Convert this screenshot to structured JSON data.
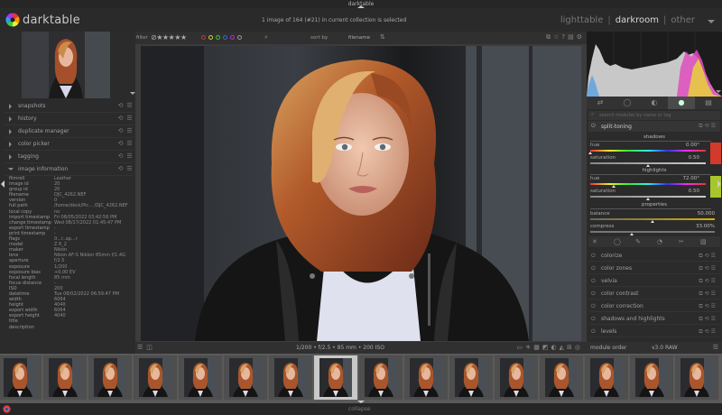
{
  "window": {
    "title": "darktable"
  },
  "header": {
    "app_name": "darktable",
    "selection_info": "1 image of 164 (#21) in current collection is selected",
    "views": {
      "lighttable": "lighttable",
      "darkroom": "darkroom",
      "other": "other",
      "separator": "|"
    }
  },
  "left_panel": {
    "modules": [
      {
        "label": "snapshots"
      },
      {
        "label": "history"
      },
      {
        "label": "duplicate manager"
      },
      {
        "label": "color picker"
      },
      {
        "label": "tagging"
      },
      {
        "label": "image information"
      }
    ],
    "image_info": [
      {
        "key": "filmroll",
        "value": "Leather"
      },
      {
        "key": "image id",
        "value": "20"
      },
      {
        "key": "group id",
        "value": "20"
      },
      {
        "key": "filename",
        "value": "DJC_4262.NEF"
      },
      {
        "key": "version",
        "value": "0"
      },
      {
        "key": "full path",
        "value": "/home/deck/Pic... /DJC_4262.NEF"
      },
      {
        "key": "local copy",
        "value": "no"
      },
      {
        "key": "import timestamp",
        "value": "Fri 08/05/2022 03:42:56 PM"
      },
      {
        "key": "change timestamp",
        "value": "Wed 08/17/2022 01:45:47 PM"
      },
      {
        "key": "export timestamp",
        "value": "-"
      },
      {
        "key": "print timestamp",
        "value": "-"
      },
      {
        "key": "flags",
        "value": "0...r..ap...r"
      },
      {
        "key": "model",
        "value": "Z 6_2"
      },
      {
        "key": "maker",
        "value": "Nikon"
      },
      {
        "key": "lens",
        "value": "Nikon AF-S Nikkor 85mm f/1.4G"
      },
      {
        "key": "aperture",
        "value": "f/2.5"
      },
      {
        "key": "exposure",
        "value": "1/200"
      },
      {
        "key": "exposure bias",
        "value": "+0.00 EV"
      },
      {
        "key": "focal length",
        "value": "85 mm"
      },
      {
        "key": "focus distance",
        "value": "-"
      },
      {
        "key": "ISO",
        "value": "200"
      },
      {
        "key": "datetime",
        "value": "Tue 08/02/2022 06:59:47 PM"
      },
      {
        "key": "width",
        "value": "6064"
      },
      {
        "key": "height",
        "value": "4040"
      },
      {
        "key": "export width",
        "value": "6064"
      },
      {
        "key": "export height",
        "value": "4040"
      },
      {
        "key": "title",
        "value": ""
      },
      {
        "key": "description",
        "value": ""
      }
    ]
  },
  "center": {
    "filter_label": "filter",
    "stars": "⊘★★★★★",
    "sort_by_label": "sort by",
    "sort_value": "filename",
    "exif_summary": "1/200 • f/2.5 • 85 mm • 200 ISO"
  },
  "right_panel": {
    "search_placeholder": "search modules by name or tag",
    "active_module": "split-toning",
    "shadows": {
      "title": "shadows",
      "hue_label": "hue",
      "hue_value": "0.00°",
      "sat_label": "saturation",
      "sat_value": "0.50",
      "swatch": "#d33a2c",
      "hue_pos": 0.0,
      "sat_pos": 0.5
    },
    "highlights": {
      "title": "highlights",
      "hue_label": "hue",
      "hue_value": "72.00°",
      "sat_label": "saturation",
      "sat_value": "0.50",
      "swatch": "#a7c62c",
      "hue_pos": 0.2,
      "sat_pos": 0.5
    },
    "properties": {
      "title": "properties",
      "balance_label": "balance",
      "balance_value": "50.000",
      "compress_label": "compress",
      "compress_value": "33.00%",
      "balance_pos": 0.5,
      "compress_pos": 0.33
    },
    "module_list": [
      {
        "label": "colorize"
      },
      {
        "label": "color zones"
      },
      {
        "label": "velvia"
      },
      {
        "label": "color contrast"
      },
      {
        "label": "color correction"
      },
      {
        "label": "shadows and highlights"
      },
      {
        "label": "levels"
      }
    ],
    "module_order_label": "module order",
    "module_order_value": "v3.0 RAW"
  },
  "footer": {
    "label": "collapse"
  },
  "colors": {
    "accent_group_tab": "#4a4a4a",
    "filmstrip_bg": "#5a5a5a"
  }
}
